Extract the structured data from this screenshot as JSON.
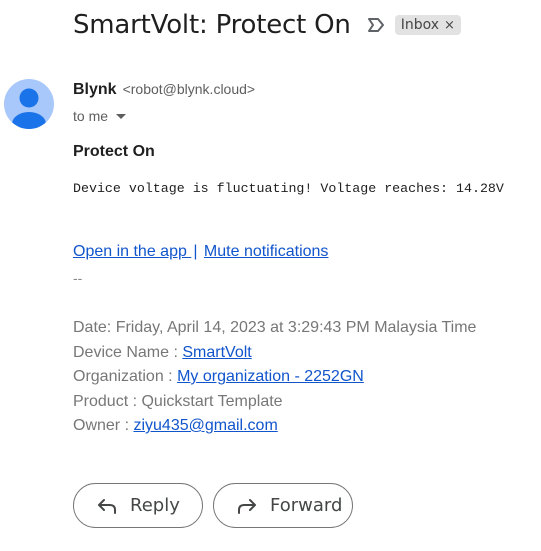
{
  "email": {
    "subject": "SmartVolt: Protect On",
    "label": "Inbox",
    "label_close": "×",
    "sender_name": "Blynk",
    "sender_email": "<robot@blynk.cloud>",
    "recipient_summary": "to me",
    "body_title": "Protect On",
    "body_message": "Device voltage is fluctuating! Voltage reaches: 14.28V",
    "links": {
      "open_app": "Open in the app ",
      "separator": "|",
      "mute": "Mute notifications"
    },
    "signature_dashes": "--",
    "details": {
      "date": "Date: Friday, April 14, 2023 at 3:29:43 PM Malaysia Time",
      "device_label": "Device Name : ",
      "device_value": "SmartVolt",
      "org_label": "Organization : ",
      "org_value": "My organization - 2252GN",
      "product": "Product : Quickstart Template",
      "owner_label": "Owner : ",
      "owner_value": "ziyu435@gmail.com"
    }
  },
  "actions": {
    "reply": "Reply",
    "forward": "Forward"
  },
  "icons": {
    "importance": "importance-marker-icon",
    "avatar": "person-icon",
    "reply": "reply-arrow-icon",
    "forward": "forward-arrow-icon"
  },
  "colors": {
    "link": "#1155cc",
    "avatar_bg": "#a8c7fa",
    "avatar_fg": "#1a73e8",
    "chip_bg": "#e2e2e2"
  }
}
